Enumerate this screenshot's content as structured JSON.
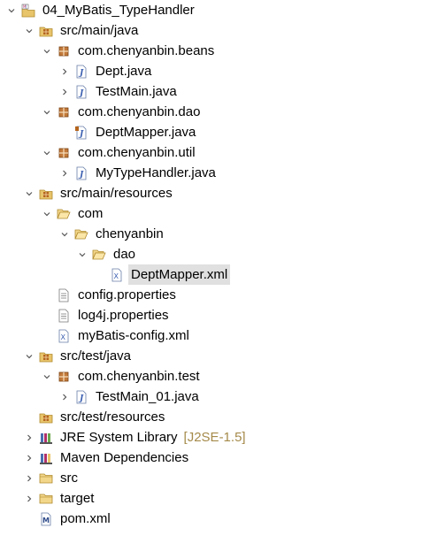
{
  "tree": {
    "nodes": [
      {
        "label": "04_MyBatis_TypeHandler",
        "depth": 0,
        "twisty": "open",
        "icon": "maven-project-icon"
      },
      {
        "label": "src/main/java",
        "depth": 1,
        "twisty": "open",
        "icon": "source-folder-icon"
      },
      {
        "label": "com.chenyanbin.beans",
        "depth": 2,
        "twisty": "open",
        "icon": "package-icon"
      },
      {
        "label": "Dept.java",
        "depth": 3,
        "twisty": "closed",
        "icon": "java-file-icon"
      },
      {
        "label": "TestMain.java",
        "depth": 3,
        "twisty": "closed",
        "icon": "java-file-icon"
      },
      {
        "label": "com.chenyanbin.dao",
        "depth": 2,
        "twisty": "open",
        "icon": "package-icon"
      },
      {
        "label": "DeptMapper.java",
        "depth": 3,
        "twisty": "none",
        "icon": "java-interface-file-icon"
      },
      {
        "label": "com.chenyanbin.util",
        "depth": 2,
        "twisty": "open",
        "icon": "package-icon"
      },
      {
        "label": "MyTypeHandler.java",
        "depth": 3,
        "twisty": "closed",
        "icon": "java-file-icon"
      },
      {
        "label": "src/main/resources",
        "depth": 1,
        "twisty": "open",
        "icon": "source-folder-icon"
      },
      {
        "label": "com",
        "depth": 2,
        "twisty": "open",
        "icon": "open-folder-icon"
      },
      {
        "label": "chenyanbin",
        "depth": 3,
        "twisty": "open",
        "icon": "open-folder-icon"
      },
      {
        "label": "dao",
        "depth": 4,
        "twisty": "open",
        "icon": "open-folder-icon"
      },
      {
        "label": "DeptMapper.xml",
        "depth": 5,
        "twisty": "none",
        "icon": "xml-file-icon",
        "selected": true
      },
      {
        "label": "config.properties",
        "depth": 2,
        "twisty": "none",
        "icon": "text-file-icon"
      },
      {
        "label": "log4j.properties",
        "depth": 2,
        "twisty": "none",
        "icon": "text-file-icon"
      },
      {
        "label": "myBatis-config.xml",
        "depth": 2,
        "twisty": "none",
        "icon": "xml-file-icon"
      },
      {
        "label": "src/test/java",
        "depth": 1,
        "twisty": "open",
        "icon": "source-folder-icon"
      },
      {
        "label": "com.chenyanbin.test",
        "depth": 2,
        "twisty": "open",
        "icon": "package-icon"
      },
      {
        "label": "TestMain_01.java",
        "depth": 3,
        "twisty": "closed",
        "icon": "java-file-icon"
      },
      {
        "label": "src/test/resources",
        "depth": 1,
        "twisty": "none",
        "icon": "source-folder-icon"
      },
      {
        "label": "JRE System Library",
        "decoration": "[J2SE-1.5]",
        "depth": 1,
        "twisty": "closed",
        "icon": "library-icon"
      },
      {
        "label": "Maven Dependencies",
        "depth": 1,
        "twisty": "closed",
        "icon": "maven-library-icon"
      },
      {
        "label": "src",
        "depth": 1,
        "twisty": "closed",
        "icon": "folder-icon"
      },
      {
        "label": "target",
        "depth": 1,
        "twisty": "closed",
        "icon": "folder-icon"
      },
      {
        "label": "pom.xml",
        "depth": 1,
        "twisty": "none",
        "icon": "maven-pom-icon"
      }
    ]
  },
  "colors": {
    "selection": "#e0e0e0",
    "decoration": "#a58a4a",
    "folder": "#e8c46a",
    "package": "#b5651d",
    "java": "#3b5fb0"
  }
}
